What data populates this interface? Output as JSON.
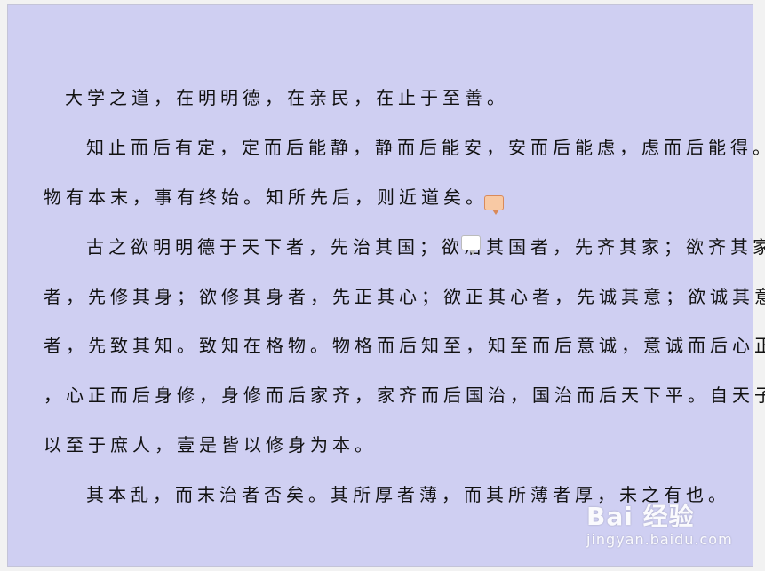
{
  "document": {
    "lines": [
      "大学之道，在明明德，在亲民，在止于至善。",
      "知止而后有定，定而后能静，静而后能安，安而后能虑，虑而后能得。",
      "物有本末，事有终始。知所先后，则近道矣。",
      "古之欲明明德于天下者，先治其国；欲治其国者，先齐其家；欲齐其家",
      "者，先修其身；欲修其身者，先正其心；欲正其心者，先诚其意；欲诚其意",
      "者，先致其知。致知在格物。物格而后知至，知至而后意诚，意诚而后心正",
      "，心正而后身修，身修而后家齐，家齐而后国治，国治而后天下平。自天子",
      "以至于庶人，壹是皆以修身为本。",
      "其本乱，而末治者否矣。其所厚者薄，而其所薄者厚，未之有也。"
    ]
  },
  "watermark": {
    "logo": "Bai 经验",
    "site": "jingyan.baidu.com"
  }
}
